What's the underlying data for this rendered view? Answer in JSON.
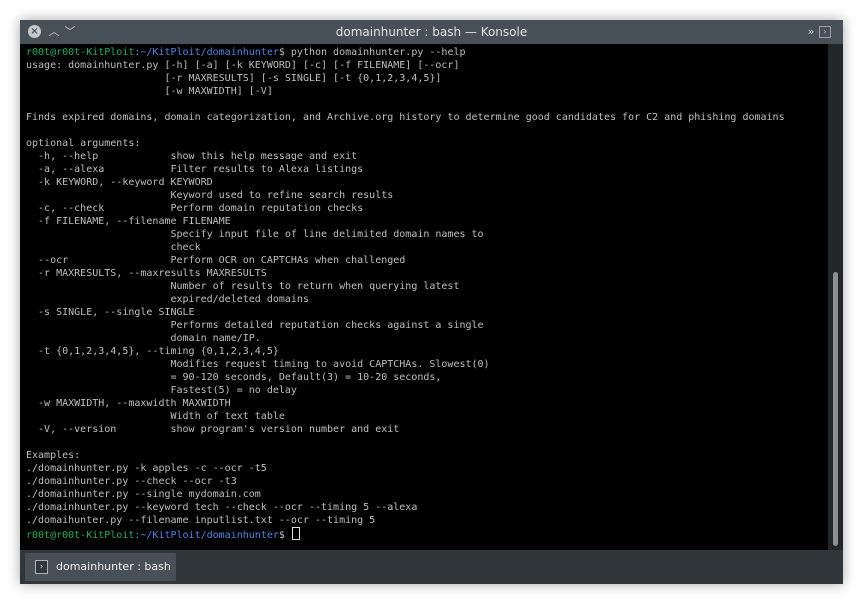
{
  "window": {
    "title": "domainhunter : bash — Konsole"
  },
  "terminal": {
    "lines": [
      {
        "user": "r00t@r00t-KitPloit",
        "path": ":~/KitPloit/domainhunter",
        "cmd": "$ python domainhunter.py --help"
      },
      {
        "text": "usage: domainhunter.py [-h] [-a] [-k KEYWORD] [-c] [-f FILENAME] [--ocr]"
      },
      {
        "text": "                       [-r MAXRESULTS] [-s SINGLE] [-t {0,1,2,3,4,5}]"
      },
      {
        "text": "                       [-w MAXWIDTH] [-V]"
      },
      {
        "text": ""
      },
      {
        "text": "Finds expired domains, domain categorization, and Archive.org history to determine good candidates for C2 and phishing domains"
      },
      {
        "text": ""
      },
      {
        "text": "optional arguments:"
      },
      {
        "text": "  -h, --help            show this help message and exit"
      },
      {
        "text": "  -a, --alexa           Filter results to Alexa listings"
      },
      {
        "text": "  -k KEYWORD, --keyword KEYWORD"
      },
      {
        "text": "                        Keyword used to refine search results"
      },
      {
        "text": "  -c, --check           Perform domain reputation checks"
      },
      {
        "text": "  -f FILENAME, --filename FILENAME"
      },
      {
        "text": "                        Specify input file of line delimited domain names to"
      },
      {
        "text": "                        check"
      },
      {
        "text": "  --ocr                 Perform OCR on CAPTCHAs when challenged"
      },
      {
        "text": "  -r MAXRESULTS, --maxresults MAXRESULTS"
      },
      {
        "text": "                        Number of results to return when querying latest"
      },
      {
        "text": "                        expired/deleted domains"
      },
      {
        "text": "  -s SINGLE, --single SINGLE"
      },
      {
        "text": "                        Performs detailed reputation checks against a single"
      },
      {
        "text": "                        domain name/IP."
      },
      {
        "text": "  -t {0,1,2,3,4,5}, --timing {0,1,2,3,4,5}"
      },
      {
        "text": "                        Modifies request timing to avoid CAPTCHAs. Slowest(0)"
      },
      {
        "text": "                        = 90-120 seconds, Default(3) = 10-20 seconds,"
      },
      {
        "text": "                        Fastest(5) = no delay"
      },
      {
        "text": "  -w MAXWIDTH, --maxwidth MAXWIDTH"
      },
      {
        "text": "                        Width of text table"
      },
      {
        "text": "  -V, --version         show program's version number and exit"
      },
      {
        "text": ""
      },
      {
        "text": "Examples:"
      },
      {
        "text": "./domainhunter.py -k apples -c --ocr -t5"
      },
      {
        "text": "./domainhunter.py --check --ocr -t3"
      },
      {
        "text": "./domainhunter.py --single mydomain.com"
      },
      {
        "text": "./domainhunter.py --keyword tech --check --ocr --timing 5 --alexa"
      },
      {
        "text": "./domaihunter.py --filename inputlist.txt --ocr --timing 5"
      },
      {
        "user": "r00t@r00t-KitPloit",
        "path": ":~/KitPloit/domainhunter",
        "cmd": "$ ",
        "cursor": true
      }
    ]
  },
  "tabs": [
    {
      "label": "domainhunter : bash",
      "icon": "terminal-icon"
    }
  ],
  "colors": {
    "prompt_user": "#17b35a",
    "prompt_path": "#4a86e8",
    "text": "#bfbfbf",
    "background": "#000000"
  }
}
